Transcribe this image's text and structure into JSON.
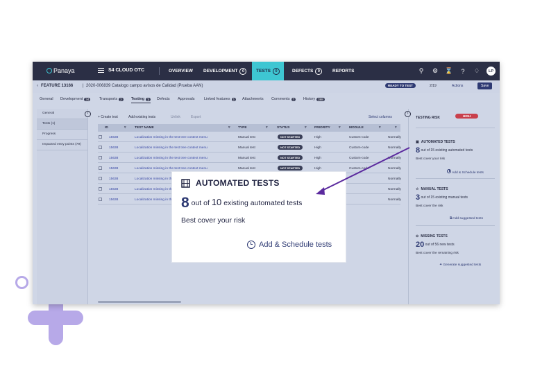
{
  "app": {
    "logo": "Panaya",
    "project": "S4 CLOUD OTC",
    "nav": [
      {
        "label": "OVERVIEW",
        "count": ""
      },
      {
        "label": "DEVELOPMENT",
        "count": "0"
      },
      {
        "label": "TESTS",
        "count": "0"
      },
      {
        "label": "DEFECTS",
        "count": "0"
      },
      {
        "label": "REPORTS",
        "count": ""
      }
    ],
    "user_initials": "LP"
  },
  "feature": {
    "id": "FEATURE 13166",
    "separator": "|",
    "title": "2020-006839 Catalogo campo avisos de Calidad (Prueba AAN)",
    "status": "READY TO TEST",
    "pager": "2/19",
    "actions": "Actions",
    "save": "Save"
  },
  "tabs": [
    {
      "label": "General",
      "badge": ""
    },
    {
      "label": "Development",
      "badge": "34"
    },
    {
      "label": "Transports",
      "badge": "2"
    },
    {
      "label": "Testing",
      "badge": "1"
    },
    {
      "label": "Defects",
      "badge": ""
    },
    {
      "label": "Approvals",
      "badge": ""
    },
    {
      "label": "Linked features",
      "badge": "1"
    },
    {
      "label": "Attachments",
      "badge": ""
    },
    {
      "label": "Comments",
      "badge": "7"
    },
    {
      "label": "History",
      "badge": "388"
    }
  ],
  "left_nav": [
    "General",
    "Tests (1)",
    "Progress",
    "Impacted entry points (79)"
  ],
  "toolbar": {
    "create": "+ Create test",
    "add_existing": "Add existing tests",
    "unlink": "Unlink",
    "export": "Export",
    "select_columns": "Select columns"
  },
  "table": {
    "headers": [
      "ID",
      "TEST NAME",
      "TYPE",
      "STATUS",
      "PRIORITY",
      "MODULE"
    ],
    "rows": [
      {
        "id": "15638",
        "name": "Localization missing in the test tree context menu",
        "type": "Manual test",
        "status": "NOT STARTED",
        "priority": "High",
        "module": "Custom-code",
        "extra": "Normally"
      },
      {
        "id": "15638",
        "name": "Localization missing in the test tree context menu",
        "type": "Manual test",
        "status": "NOT STARTED",
        "priority": "High",
        "module": "Custom-code",
        "extra": "Normally"
      },
      {
        "id": "15638",
        "name": "Localization missing in the test tree context menu",
        "type": "Manual test",
        "status": "NOT STARTED",
        "priority": "High",
        "module": "Custom-code",
        "extra": "Normally"
      },
      {
        "id": "15638",
        "name": "Localization missing in the test tree context menu",
        "type": "Manual test",
        "status": "NOT STARTED",
        "priority": "High",
        "module": "Custom-code",
        "extra": "Normally"
      },
      {
        "id": "15638",
        "name": "Localization missing in the test tree",
        "type": "",
        "status": "",
        "priority": "",
        "module": "",
        "extra": "Normally"
      },
      {
        "id": "15638",
        "name": "Localization missing in the test tree",
        "type": "",
        "status": "",
        "priority": "",
        "module": "",
        "extra": "Normally"
      },
      {
        "id": "15638",
        "name": "Localization missing in the test tree",
        "type": "",
        "status": "",
        "priority": "",
        "module": "",
        "extra": "Normally"
      }
    ]
  },
  "risk_panel": {
    "title": "TESTING RISK",
    "level": "HIGH",
    "automated": {
      "heading": "AUTOMATED TESTS",
      "count": "8",
      "total_text": "out of 15 existing automated tests",
      "sub": "Best cover your risk",
      "link": "Add & Schedule tests"
    },
    "manual": {
      "heading": "MANUAL TESTS",
      "count": "3",
      "total_text": "out of 15 existing manual tests",
      "sub": "Best cover the risk",
      "link": "Add suggested tests"
    },
    "missing": {
      "heading": "MISSING TESTS",
      "count": "20",
      "total_text": "out of 56 new tests",
      "sub": "Best cover the remaining risk",
      "link": "Generate suggested tests"
    }
  },
  "callout": {
    "heading": "AUTOMATED TESTS",
    "count": "8",
    "out_of": "out of",
    "total": "10",
    "suffix": "existing automated tests",
    "sub": "Best cover your risk",
    "link": "Add & Schedule tests"
  },
  "colors": {
    "nav_bg": "#2b2f45",
    "accent": "#3ec6d2",
    "arrow": "#5b2a9e",
    "decor": "#b7a9e8",
    "high": "#c9404c"
  }
}
